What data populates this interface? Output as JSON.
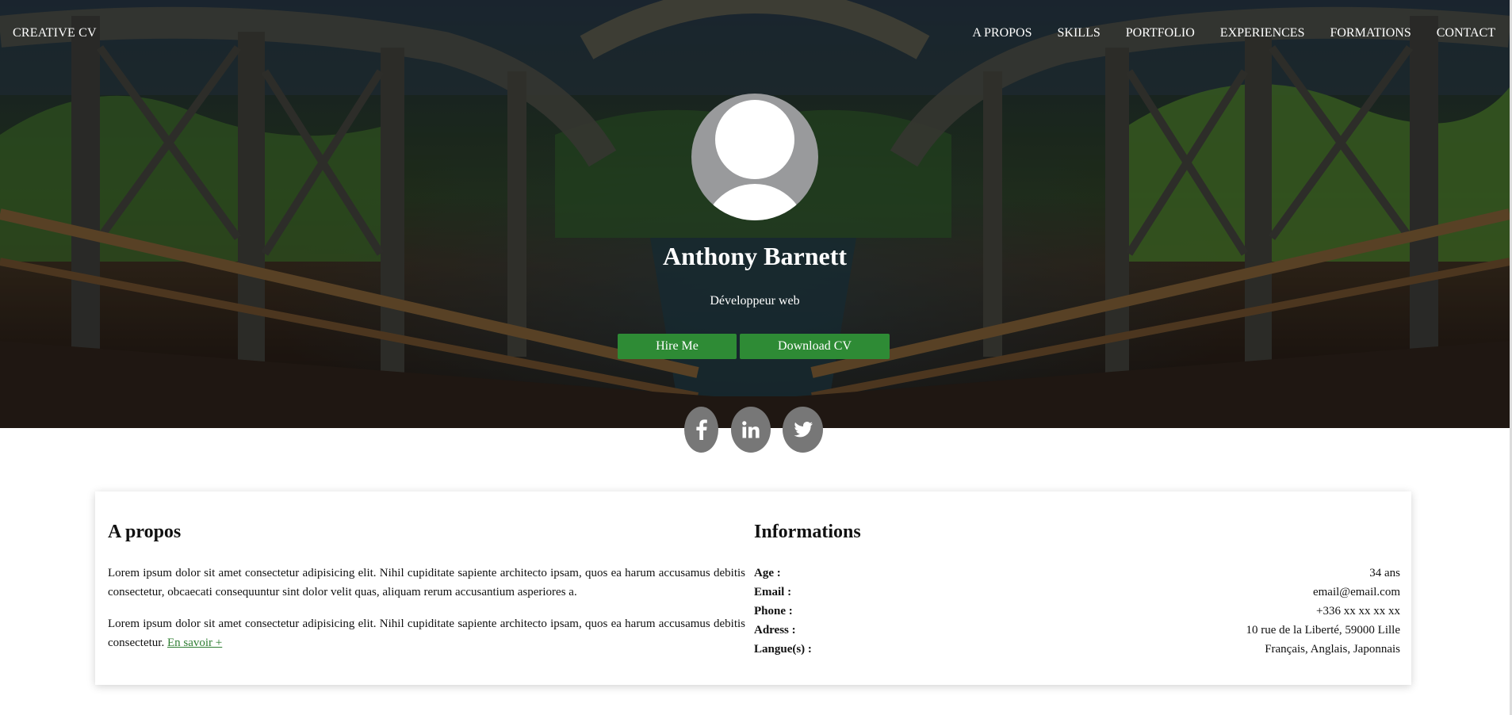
{
  "header": {
    "brand": "CREATIVE CV",
    "nav": [
      "A PROPOS",
      "SKILLS",
      "PORTFOLIO",
      "EXPERIENCES",
      "FORMATIONS",
      "CONTACT"
    ]
  },
  "hero": {
    "name": "Anthony Barnett",
    "job_title": "Développeur web",
    "hire_label": "Hire Me",
    "download_label": "Download CV"
  },
  "social": [
    {
      "icon": "facebook-icon"
    },
    {
      "icon": "linkedin-icon"
    },
    {
      "icon": "twitter-icon"
    }
  ],
  "about": {
    "title": "A propos",
    "paragraph1": "Lorem ipsum dolor sit amet consectetur adipisicing elit. Nihil cupiditate sapiente architecto ipsam, quos ea harum accusamus debitis consectetur, obcaecati consequuntur sint dolor velit quas, aliquam rerum accusantium asperiores a.",
    "paragraph2": "Lorem ipsum dolor sit amet consectetur adipisicing elit. Nihil cupiditate sapiente architecto ipsam, quos ea harum accusamus debitis consectetur.",
    "more_link": "En savoir +"
  },
  "informations": {
    "title": "Informations",
    "rows": [
      {
        "label": "Age :",
        "value": "34 ans"
      },
      {
        "label": "Email :",
        "value": "email@email.com"
      },
      {
        "label": "Phone :",
        "value": "+336 xx xx xx xx"
      },
      {
        "label": "Adress :",
        "value": "10 rue de la Liberté, 59000 Lille"
      },
      {
        "label": "Langue(s) :",
        "value": "Français, Anglais, Japonnais"
      }
    ]
  },
  "colors": {
    "accent": "#2e8b35",
    "social_bg": "#777777"
  }
}
